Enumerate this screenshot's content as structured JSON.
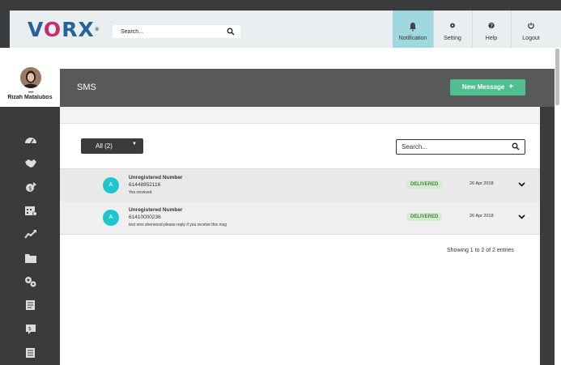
{
  "header": {
    "logo": {
      "v": "V",
      "o": "O",
      "rest": "RX",
      "tm": "®"
    },
    "search_placeholder": "Search...",
    "nav": [
      {
        "label": "Notification",
        "icon": "bell-icon",
        "active": true
      },
      {
        "label": "Setting",
        "icon": "gear-icon",
        "active": false
      },
      {
        "label": "Help",
        "icon": "help-icon",
        "active": false
      },
      {
        "label": "Logout",
        "icon": "power-icon",
        "active": false
      }
    ]
  },
  "profile": {
    "dots": "•••",
    "name": "Rizah Matalubos"
  },
  "sidebar": {
    "icons": [
      "dashboard-icon",
      "handshake-icon",
      "money-icon",
      "calendar-icon",
      "chart-icon",
      "folder-icon",
      "gears-icon",
      "report-icon",
      "sms-icon",
      "document-icon"
    ]
  },
  "page": {
    "title": "SMS",
    "new_button": "New Message",
    "new_button_icon": "+"
  },
  "filter": {
    "value": "All (2)",
    "caret": "▼"
  },
  "search": {
    "placeholder": "Search..."
  },
  "messages": [
    {
      "avatar": "A",
      "name": "Unregistered Number",
      "number": "61448852116",
      "text": "Yes received",
      "status": "DELIVERED",
      "date": "26 Apr 2018"
    },
    {
      "avatar": "A",
      "name": "Unregistered Number",
      "number": "61410000236",
      "text": "test sms sherwood please reply if you receive this msg",
      "status": "DELIVERED",
      "date": "26 Apr 2018"
    }
  ],
  "footer": {
    "showing": "Showing 1 to 2 of 2 entries"
  },
  "colors": {
    "accent": "#4fbf8f",
    "avatar": "#1ec6cc",
    "active_nav": "#9fd8de",
    "sidebar": "#3a3b3d"
  }
}
